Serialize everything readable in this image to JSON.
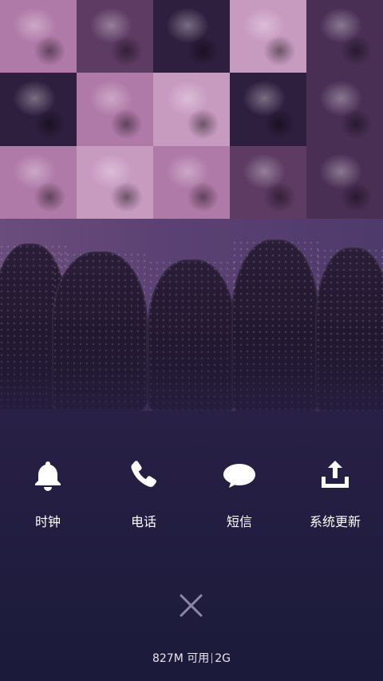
{
  "shortcuts": [
    {
      "label": "时钟",
      "icon": "bell-icon"
    },
    {
      "label": "电话",
      "icon": "phone-icon"
    },
    {
      "label": "短信",
      "icon": "message-icon"
    },
    {
      "label": "系统更新",
      "icon": "upload-icon"
    }
  ],
  "close": {
    "icon": "close-icon"
  },
  "memory": {
    "available": "827M 可用",
    "total": "2G"
  },
  "colors": {
    "background_top": "#3a2a52",
    "background_bottom": "#1b1a3a",
    "icon": "#ffffff",
    "text": "#ffffff"
  }
}
